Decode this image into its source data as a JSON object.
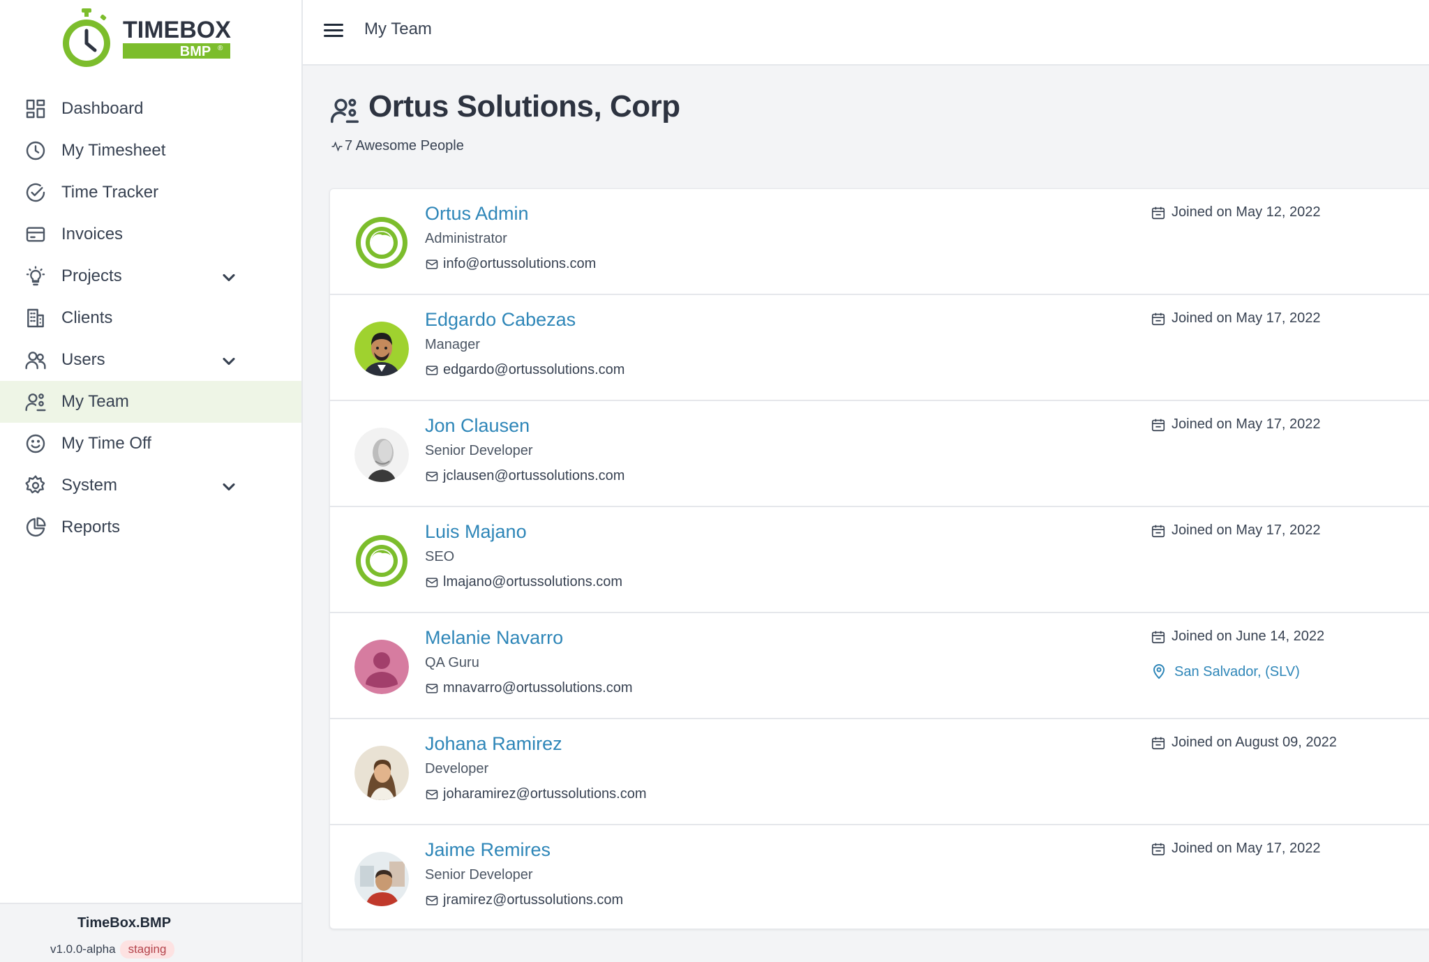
{
  "brand": {
    "logo_word": "TIMEBOX",
    "logo_sub": "BMP",
    "logo_mark": "®",
    "colors": {
      "green": "#7cbd2c",
      "dark": "#2d3340",
      "link": "#2e86b8"
    }
  },
  "sidebar": {
    "items": [
      {
        "label": "Dashboard",
        "icon": "dashboard-icon"
      },
      {
        "label": "My Timesheet",
        "icon": "clock-icon"
      },
      {
        "label": "Time Tracker",
        "icon": "check-circle-icon"
      },
      {
        "label": "Invoices",
        "icon": "invoice-card-icon"
      },
      {
        "label": "Projects",
        "icon": "lightbulb-icon"
      },
      {
        "label": "Clients",
        "icon": "building-icon"
      },
      {
        "label": "Users",
        "icon": "users-icon"
      },
      {
        "label": "My Team",
        "icon": "team-icon",
        "active": true
      },
      {
        "label": "My Time Off",
        "icon": "smile-icon"
      },
      {
        "label": "System",
        "icon": "gear-icon"
      },
      {
        "label": "Reports",
        "icon": "pie-chart-icon"
      }
    ],
    "footer": {
      "app_name": "TimeBox.BMP",
      "version": "v1.0.0-alpha",
      "env": "staging"
    }
  },
  "topbar": {
    "title": "My Team",
    "menu_icon": "hamburger-icon"
  },
  "header": {
    "title": "Ortus Solutions, Corp",
    "subtitle": "7 Awesome People"
  },
  "members": [
    {
      "name": "Ortus Admin",
      "role": "Administrator",
      "email": "info@ortussolutions.com",
      "joined": "Joined on May 12, 2022",
      "location": ""
    },
    {
      "name": "Edgardo Cabezas",
      "role": "Manager",
      "email": "edgardo@ortussolutions.com",
      "joined": "Joined on May 17, 2022",
      "location": ""
    },
    {
      "name": "Jon Clausen",
      "role": "Senior Developer",
      "email": "jclausen@ortussolutions.com",
      "joined": "Joined on May 17, 2022",
      "location": ""
    },
    {
      "name": "Luis Majano",
      "role": "SEO",
      "email": "lmajano@ortussolutions.com",
      "joined": "Joined on May 17, 2022",
      "location": ""
    },
    {
      "name": "Melanie Navarro",
      "role": "QA Guru",
      "email": "mnavarro@ortussolutions.com",
      "joined": "Joined on June 14, 2022",
      "location": "San Salvador, (SLV)"
    },
    {
      "name": "Johana Ramirez",
      "role": "Developer",
      "email": "joharamirez@ortussolutions.com",
      "joined": "Joined on August 09, 2022",
      "location": ""
    },
    {
      "name": "Jaime Remires",
      "role": "Senior Developer",
      "email": "jramirez@ortussolutions.com",
      "joined": "Joined on May 17, 2022",
      "location": ""
    }
  ]
}
